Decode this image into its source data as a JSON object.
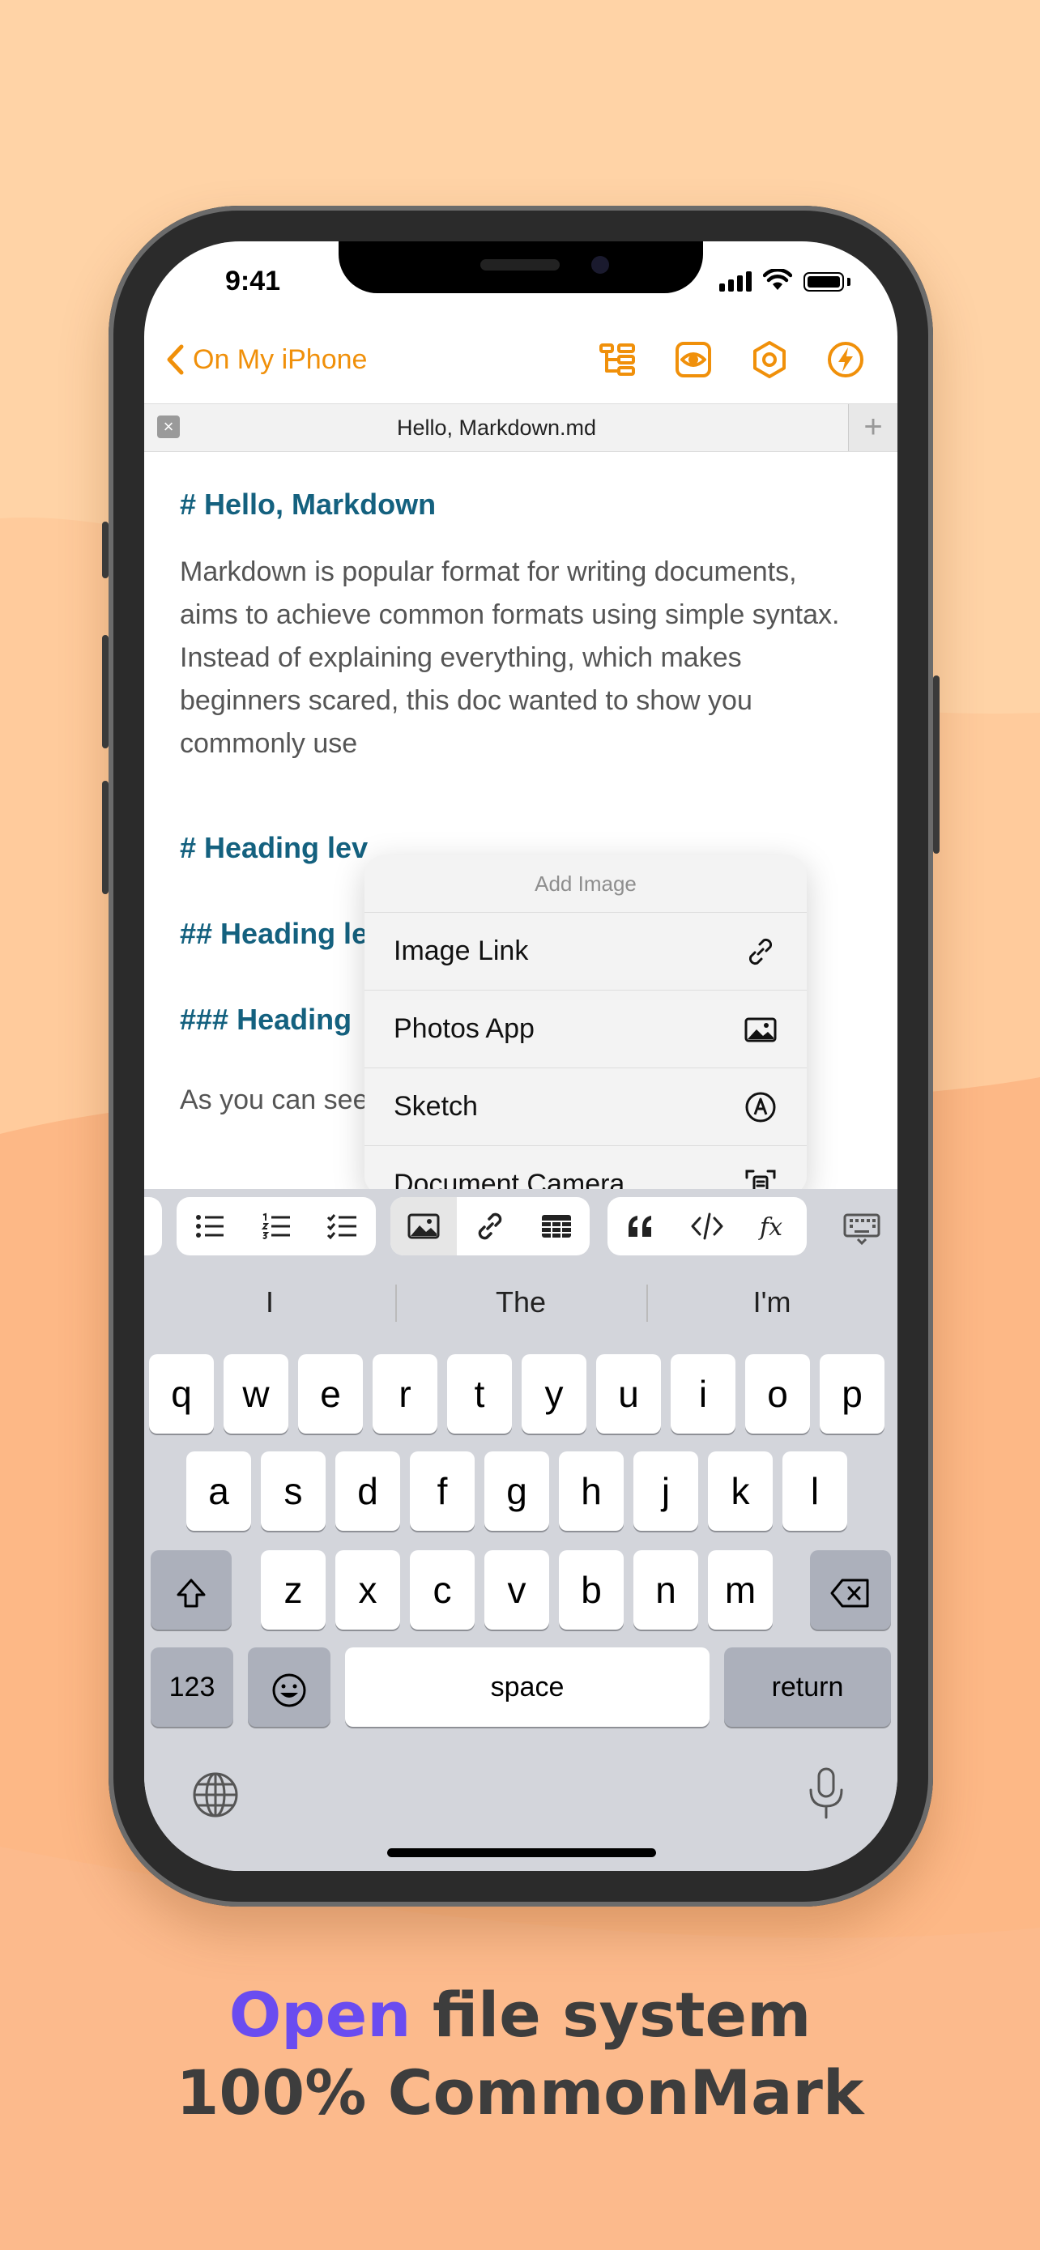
{
  "colors": {
    "accent": "#f0900a",
    "heading": "#14617f",
    "caption_accent": "#6a4cf0",
    "caption": "#3d3d3d"
  },
  "status": {
    "time": "9:41"
  },
  "nav": {
    "back_label": "On My iPhone",
    "icons": [
      "outline-icon",
      "preview-eye-icon",
      "settings-hexagon-icon",
      "lightning-icon"
    ]
  },
  "tab": {
    "title": "Hello, Markdown.md",
    "close": "×",
    "add": "+"
  },
  "editor": {
    "h1": "# Hello, Markdown",
    "p1": "Markdown is popular format for writing documents, aims to achieve common formats using simple syntax.",
    "p2": "Instead of explaining everything, which makes beginners scared, this doc wanted to show you commonly use",
    "h_level1": "# Heading lev",
    "h_level2": "## Heading le",
    "h_level3": "### Heading",
    "p3": "As you can see, headings start with #, then"
  },
  "popup": {
    "title": "Add Image",
    "items": [
      {
        "label": "Image Link",
        "icon": "link-icon"
      },
      {
        "label": "Photos App",
        "icon": "photo-icon"
      },
      {
        "label": "Sketch",
        "icon": "pen-circle-icon"
      },
      {
        "label": "Document Camera",
        "icon": "scan-doc-icon"
      }
    ]
  },
  "toolbar": {
    "buttons": [
      "bullet-list-icon",
      "numbered-list-icon",
      "checklist-icon",
      "image-icon",
      "link-icon",
      "table-icon",
      "quote-icon",
      "code-icon",
      "formula-icon",
      "keyboard-hide-icon"
    ]
  },
  "keyboard": {
    "suggestions": [
      "I",
      "The",
      "I'm"
    ],
    "row1": [
      "q",
      "w",
      "e",
      "r",
      "t",
      "y",
      "u",
      "i",
      "o",
      "p"
    ],
    "row2": [
      "a",
      "s",
      "d",
      "f",
      "g",
      "h",
      "j",
      "k",
      "l"
    ],
    "row3": [
      "z",
      "x",
      "c",
      "v",
      "b",
      "n",
      "m"
    ],
    "numbers": "123",
    "space": "space",
    "return": "return"
  },
  "caption": {
    "accent_word": "Open",
    "line1_rest": " file system",
    "line2": "100% CommonMark"
  }
}
